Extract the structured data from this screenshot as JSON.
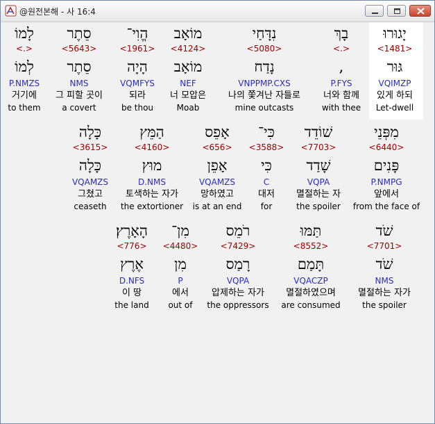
{
  "window": {
    "title": "@원전본해 - 사 16:4"
  },
  "verse_rows": [
    {
      "words": [
        {
          "hebrew": "לָמוֹ",
          "strong": "<.>",
          "lexeme": "לְמוֹ",
          "morph": "P.NMZS",
          "korean": "거기에",
          "english": "to them"
        },
        {
          "hebrew": "סֵתֶר",
          "strong": "<5643>",
          "lexeme": "סֵתֶר",
          "morph": "NMS",
          "korean": "그 피할 곳이",
          "english": "a covert"
        },
        {
          "hebrew": "הֱוִי־",
          "strong": "<1961>",
          "lexeme": "הָיָה",
          "morph": "VQMFYS",
          "korean": "되라",
          "english": "be thou"
        },
        {
          "hebrew": "מוֹאָב",
          "strong": "<4124>",
          "lexeme": "מוֹאָב",
          "morph": "NEF",
          "korean": "너 모압은",
          "english": "Moab"
        },
        {
          "hebrew": "נִדָּחַי",
          "strong": "<5080>",
          "lexeme": "נָדַח",
          "morph": "VNPPMP.CXS",
          "korean": "나의 쫓겨난 자들로",
          "english": "mine outcasts"
        },
        {
          "hebrew": "בָךְ",
          "strong": "<.>",
          "lexeme": ",",
          "morph": "P.FYS",
          "korean": "너와 함께",
          "english": "with thee"
        },
        {
          "hebrew": "יָגוּרוּ",
          "strong": "<1481>",
          "lexeme": "גּוּר",
          "morph": "VQIMZP",
          "korean": "있게 하되",
          "english": "Let-dwell"
        }
      ]
    },
    {
      "words": [
        {
          "hebrew": "כָּלָה",
          "strong": "<3615>",
          "lexeme": "כָּלָה",
          "morph": "VQAMZS",
          "korean": "그쳤고",
          "english": "ceaseth"
        },
        {
          "hebrew": "הַמֵּץ",
          "strong": "<4160>",
          "lexeme": "מוּץ",
          "morph": "D.NMS",
          "korean": "토색하는 자가",
          "english": "the extortioner"
        },
        {
          "hebrew": "אָפֵס",
          "strong": "<656>",
          "lexeme": "אָפֵן",
          "morph": "VQAMZS",
          "korean": "망하였고",
          "english": "is at an end"
        },
        {
          "hebrew": "כִּי־",
          "strong": "<3588>",
          "lexeme": "כִּי",
          "morph": "C",
          "korean": "대저",
          "english": "for"
        },
        {
          "hebrew": "שׁוֹדֵד",
          "strong": "<7703>",
          "lexeme": "שָׁדַד",
          "morph": "VQPA",
          "korean": "멸절하는 자",
          "english": "the spoiler"
        },
        {
          "hebrew": "מִפְּנֵי",
          "strong": "<6440>",
          "lexeme": "פָּנִים",
          "morph": "P.NMPG",
          "korean": "앞에서",
          "english": "from the face of"
        }
      ]
    },
    {
      "words": [
        {
          "hebrew": "הָאָרֶץ׃",
          "strong": "<776>",
          "lexeme": "אֶרֶץ",
          "morph": "D.NFS",
          "korean": "이 땅",
          "english": "the land"
        },
        {
          "hebrew": "מִן־",
          "strong": "<4480>",
          "lexeme": "מִן",
          "morph": "P",
          "korean": "에서",
          "english": "out of"
        },
        {
          "hebrew": "רֹמֵס",
          "strong": "<7429>",
          "lexeme": "רָמַס",
          "morph": "VQPA",
          "korean": "압제하는 자가",
          "english": "the oppressors"
        },
        {
          "hebrew": "תַּמּוּ",
          "strong": "<8552>",
          "lexeme": "תָּמַם",
          "morph": "VQACZP",
          "korean": "멸절하였으며",
          "english": "are consumed"
        },
        {
          "hebrew": "שֹׁד",
          "strong": "<7701>",
          "lexeme": "שֹׁד",
          "morph": "NMS",
          "korean": "멸절하는 자가",
          "english": "the spoiler"
        }
      ]
    }
  ],
  "colors": {
    "strong": "#a00000",
    "morph": "#2a2ac8",
    "highlight": "#ffffff",
    "background": "#f1f1f1"
  },
  "icons": {
    "app": "bible-app-icon",
    "minimize": "minimize-icon",
    "maximize": "maximize-icon",
    "close": "close-icon"
  }
}
